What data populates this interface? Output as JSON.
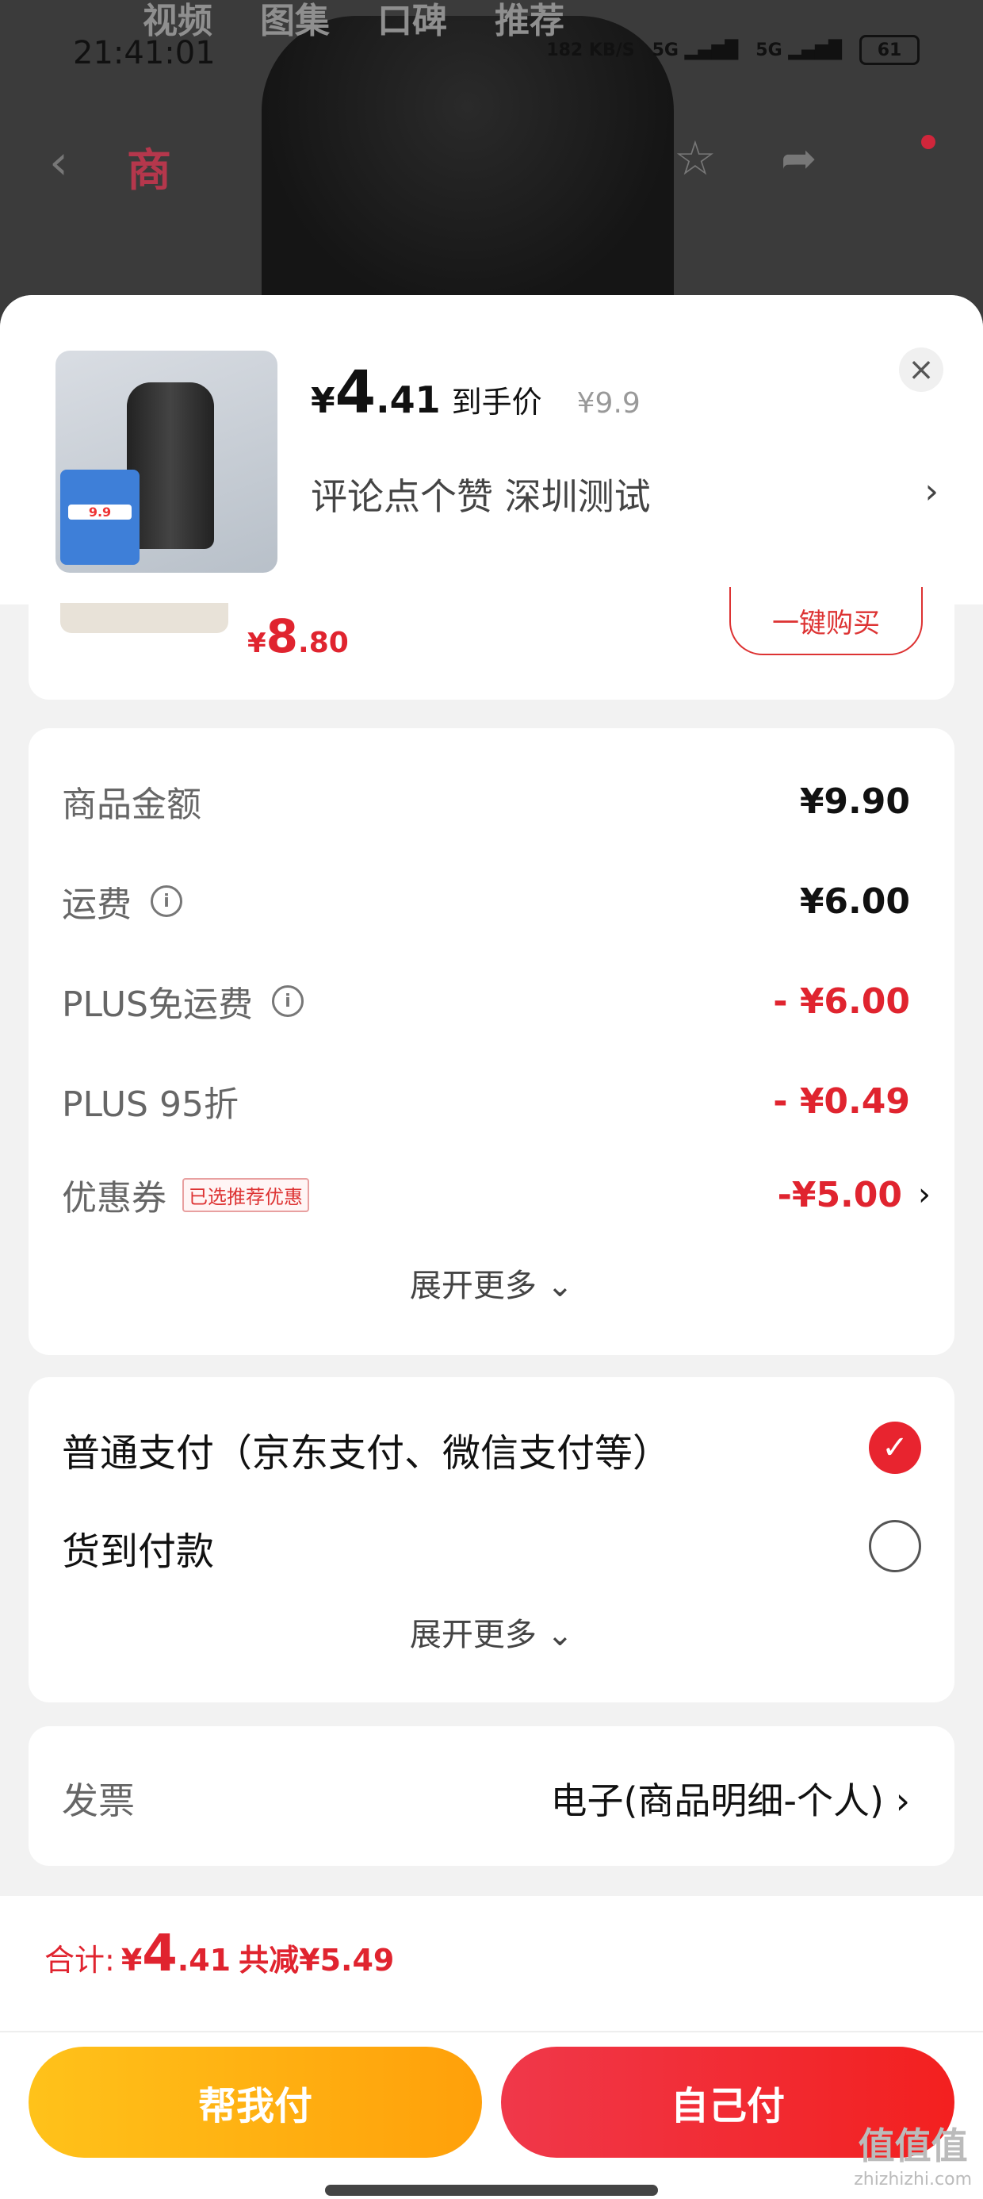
{
  "background": {
    "tabs": [
      "视频",
      "图集",
      "口碑",
      "推荐"
    ],
    "status_time": "21:41:01",
    "status_speed": "182 KB/S",
    "battery": "61",
    "nav_red_text": "商"
  },
  "sheet": {
    "price_yen": "¥",
    "price_int": "4",
    "price_dec": ".41",
    "price_label": "到手价",
    "original_price": "¥9.9",
    "promo_text": "评论点个赞  深圳测试",
    "thumb_tag": "9.9"
  },
  "partial_item": {
    "price_yen": "¥",
    "price_int": "8",
    "price_dec": ".80",
    "buy_label": "一键购买"
  },
  "summary": {
    "rows": [
      {
        "label": "商品金额",
        "value": "¥9.90"
      },
      {
        "label": "运费",
        "value": "¥6.00"
      },
      {
        "label": "PLUS免运费",
        "value": "- ¥6.00"
      },
      {
        "label": "PLUS 95折",
        "value": "- ¥0.49"
      },
      {
        "label": "优惠券",
        "tag": "已选推荐优惠",
        "value": "-¥5.00"
      }
    ],
    "expand_label": "展开更多"
  },
  "payment": {
    "options": [
      {
        "label": "普通支付（京东支付、微信支付等）",
        "selected": true
      },
      {
        "label": "货到付款",
        "selected": false
      }
    ],
    "expand_label": "展开更多"
  },
  "invoice": {
    "label": "发票",
    "value": "电子(商品明细-个人)"
  },
  "footer": {
    "total_label": "合计:",
    "total_yen": "¥",
    "total_int": "4",
    "total_dec": ".41",
    "saved": "共减¥5.49",
    "help_pay": "帮我付",
    "self_pay": "自己付"
  },
  "watermark": {
    "big": "值值值",
    "small": "zhizhizhi.com"
  },
  "colors": {
    "accent_red": "#e0242f",
    "help_yellow": "#ffb414"
  }
}
